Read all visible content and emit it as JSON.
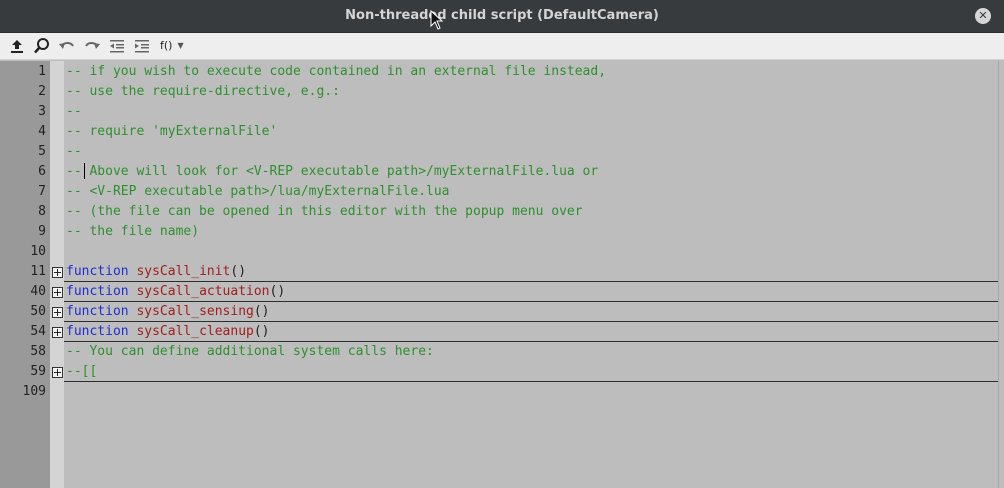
{
  "window": {
    "title": "Non-threaded child script (DefaultCamera)"
  },
  "toolbar": {
    "buttons": [
      {
        "name": "upload-icon"
      },
      {
        "name": "search-icon"
      },
      {
        "name": "undo-icon"
      },
      {
        "name": "redo-icon"
      },
      {
        "name": "outdent-icon"
      },
      {
        "name": "indent-icon"
      }
    ],
    "function_menu_label": "f()"
  },
  "editor": {
    "lines": [
      {
        "num": "1",
        "tokens": [
          {
            "t": "comment",
            "v": "-- if you wish to execute code contained in an external file instead,"
          }
        ]
      },
      {
        "num": "2",
        "tokens": [
          {
            "t": "comment",
            "v": "-- use the require-directive, e.g.:"
          }
        ]
      },
      {
        "num": "3",
        "tokens": [
          {
            "t": "comment",
            "v": "--"
          }
        ]
      },
      {
        "num": "4",
        "tokens": [
          {
            "t": "comment",
            "v": "-- require 'myExternalFile'"
          }
        ]
      },
      {
        "num": "5",
        "tokens": [
          {
            "t": "comment",
            "v": "--"
          }
        ]
      },
      {
        "num": "6",
        "tokens": [
          {
            "t": "comment",
            "v": "-- Above will look for <V-REP executable path>/myExternalFile.lua or"
          }
        ]
      },
      {
        "num": "7",
        "tokens": [
          {
            "t": "comment",
            "v": "-- <V-REP executable path>/lua/myExternalFile.lua"
          }
        ]
      },
      {
        "num": "8",
        "tokens": [
          {
            "t": "comment",
            "v": "-- (the file can be opened in this editor with the popup menu over"
          }
        ]
      },
      {
        "num": "9",
        "tokens": [
          {
            "t": "comment",
            "v": "-- the file name)"
          }
        ]
      },
      {
        "num": "10",
        "tokens": []
      },
      {
        "num": "11",
        "fold": true,
        "tokens": [
          {
            "t": "keyword",
            "v": "function"
          },
          {
            "t": "punct",
            "v": " "
          },
          {
            "t": "func",
            "v": "sysCall_init"
          },
          {
            "t": "punct",
            "v": "()"
          }
        ]
      },
      {
        "num": "40",
        "fold": true,
        "tokens": [
          {
            "t": "keyword",
            "v": "function"
          },
          {
            "t": "punct",
            "v": " "
          },
          {
            "t": "func",
            "v": "sysCall_actuation"
          },
          {
            "t": "punct",
            "v": "()"
          }
        ]
      },
      {
        "num": "50",
        "fold": true,
        "tokens": [
          {
            "t": "keyword",
            "v": "function"
          },
          {
            "t": "punct",
            "v": " "
          },
          {
            "t": "func",
            "v": "sysCall_sensing"
          },
          {
            "t": "punct",
            "v": "()"
          }
        ]
      },
      {
        "num": "54",
        "fold": true,
        "tokens": [
          {
            "t": "keyword",
            "v": "function"
          },
          {
            "t": "punct",
            "v": " "
          },
          {
            "t": "func",
            "v": "sysCall_cleanup"
          },
          {
            "t": "punct",
            "v": "()"
          }
        ]
      },
      {
        "num": "58",
        "tokens": [
          {
            "t": "comment",
            "v": "-- You can define additional system calls here:"
          }
        ]
      },
      {
        "num": "59",
        "fold": true,
        "tokens": [
          {
            "t": "comment",
            "v": "--[["
          }
        ]
      },
      {
        "num": "109",
        "tokens": []
      }
    ]
  },
  "colors": {
    "comment": "#2f8f2f",
    "keyword": "#1f2fcf",
    "function": "#a01f1f",
    "titlebar": "#383b3e",
    "code_background": "#bdbdbd"
  }
}
